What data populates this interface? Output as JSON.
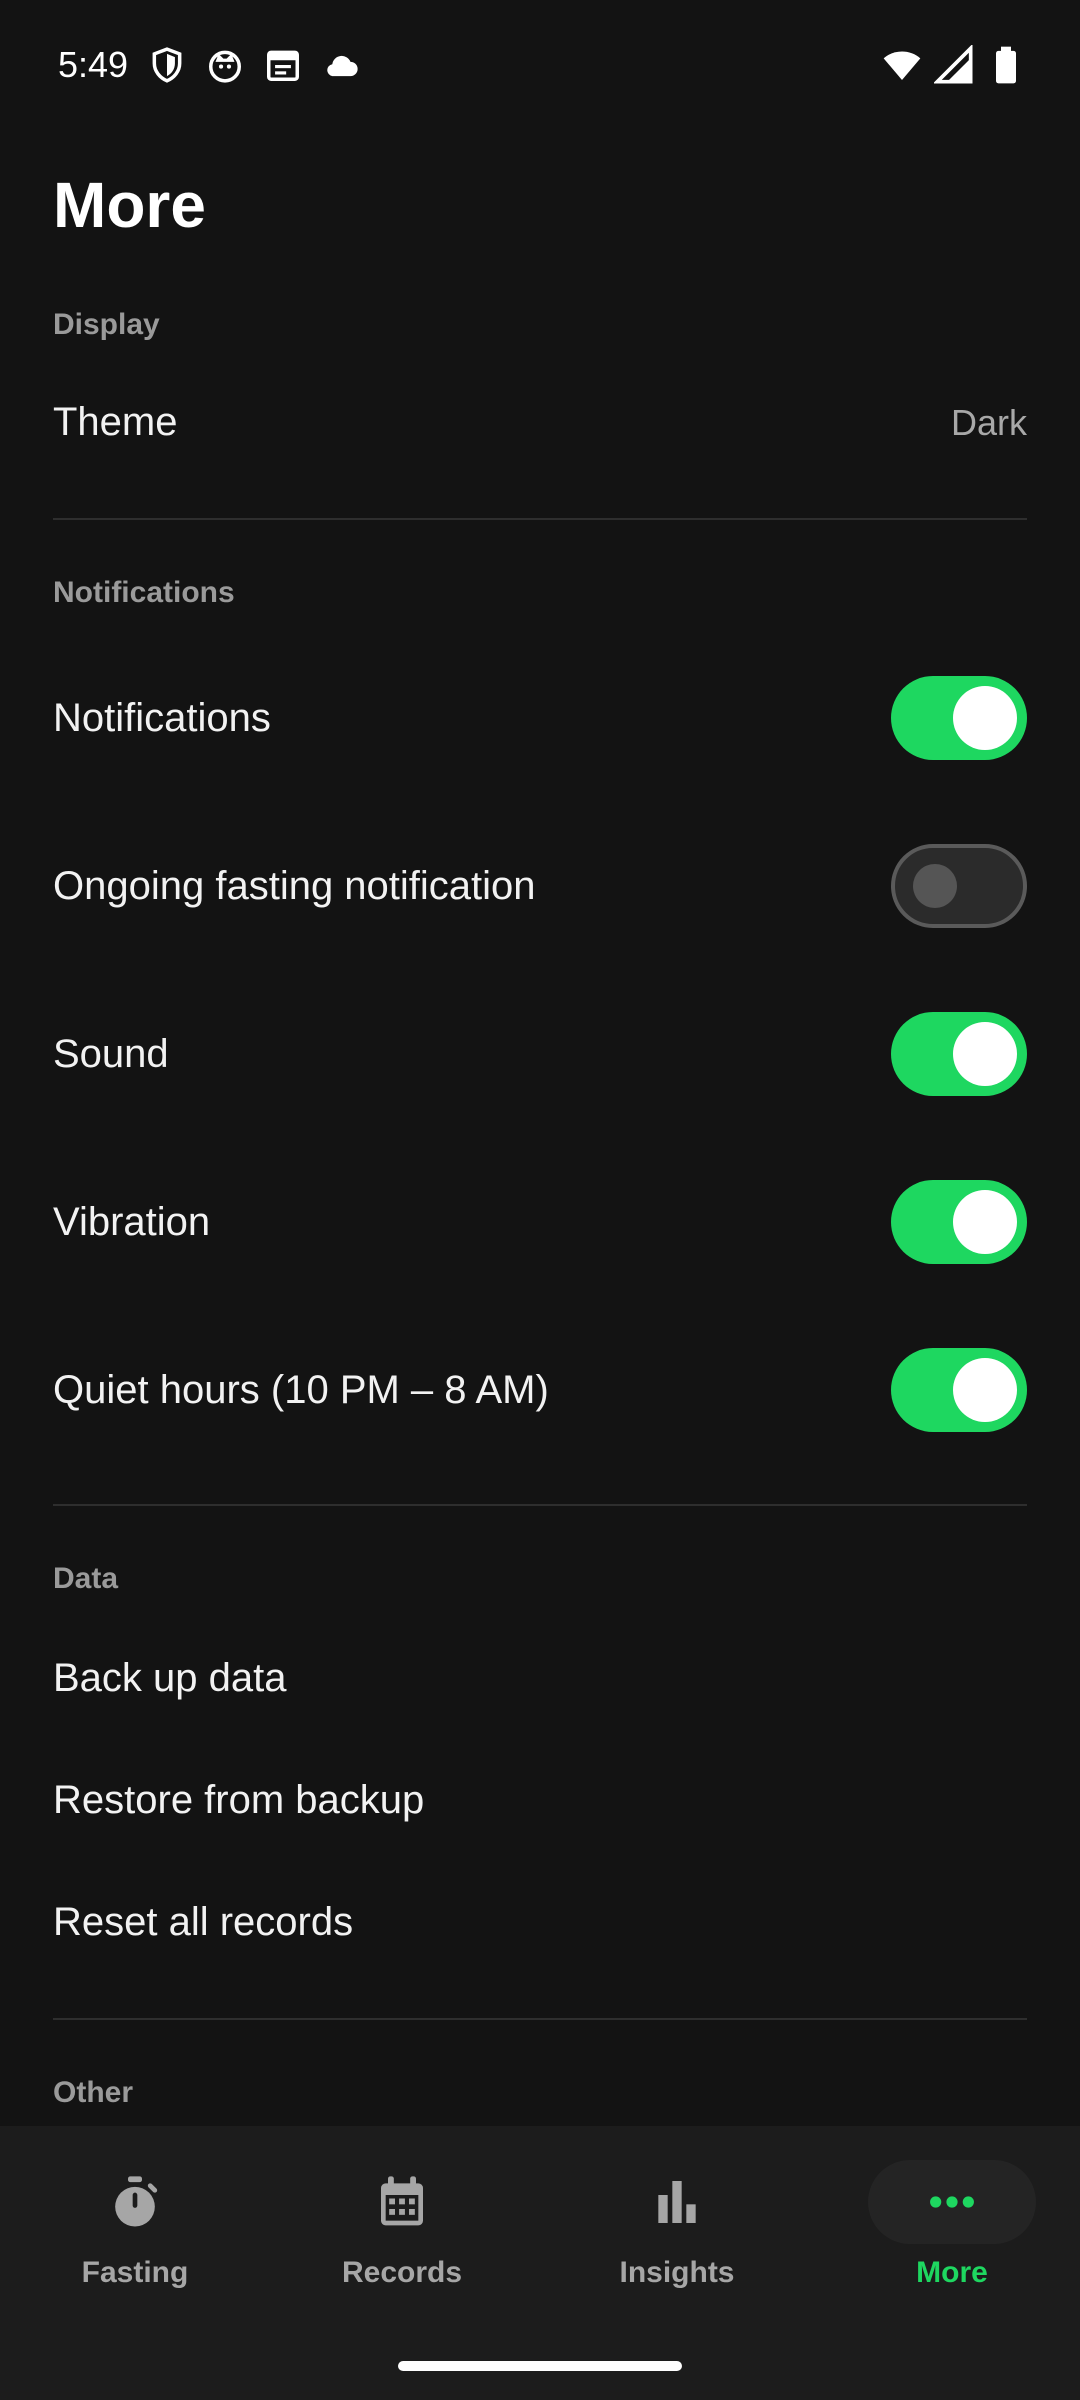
{
  "status_bar": {
    "time": "5:49",
    "icons_left": [
      "shield-icon",
      "cat-icon",
      "calendar-icon",
      "cloud-icon"
    ],
    "icons_right": [
      "wifi-icon",
      "signal-icon",
      "battery-icon"
    ]
  },
  "page": {
    "title": "More"
  },
  "sections": {
    "display": {
      "header": "Display",
      "theme_label": "Theme",
      "theme_value": "Dark"
    },
    "notifications": {
      "header": "Notifications",
      "items": [
        {
          "label": "Notifications",
          "enabled": true
        },
        {
          "label": "Ongoing fasting notification",
          "enabled": false
        },
        {
          "label": "Sound",
          "enabled": true
        },
        {
          "label": "Vibration",
          "enabled": true
        },
        {
          "label": "Quiet hours (10 PM – 8 AM)",
          "enabled": true
        }
      ]
    },
    "data": {
      "header": "Data",
      "items": [
        {
          "label": "Back up data"
        },
        {
          "label": "Restore from backup"
        },
        {
          "label": "Reset all records"
        }
      ]
    },
    "other": {
      "header": "Other"
    }
  },
  "bottom_nav": {
    "items": [
      {
        "label": "Fasting",
        "icon": "stopwatch-icon",
        "active": false
      },
      {
        "label": "Records",
        "icon": "calendar-icon",
        "active": false
      },
      {
        "label": "Insights",
        "icon": "bar-chart-icon",
        "active": false
      },
      {
        "label": "More",
        "icon": "more-dots-icon",
        "active": true
      }
    ]
  },
  "colors": {
    "accent": "#1ed760",
    "background": "#131313",
    "nav_background": "#1c1c1c"
  }
}
